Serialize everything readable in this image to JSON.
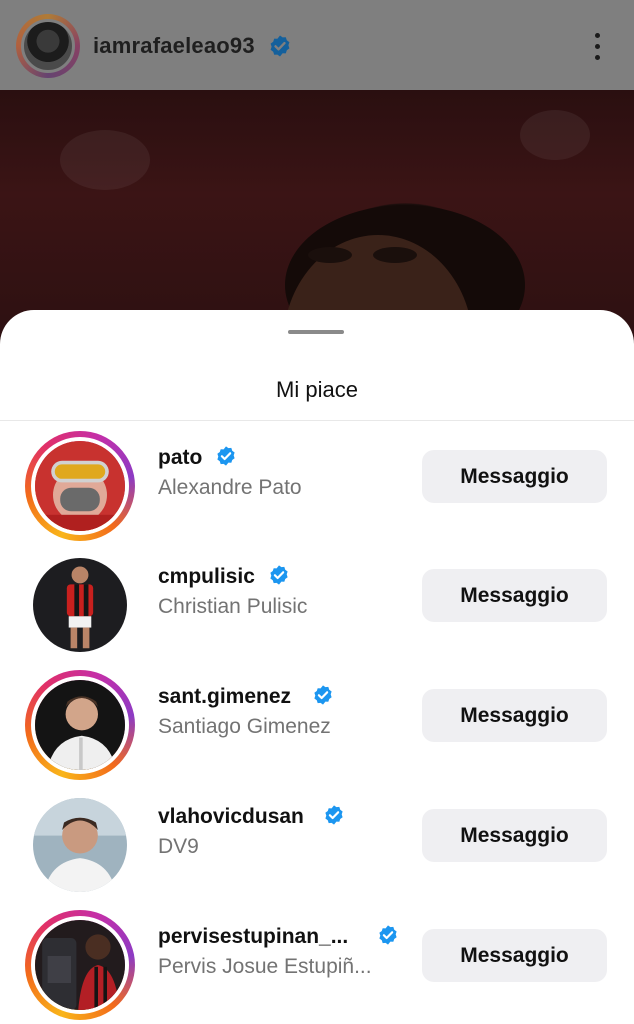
{
  "post": {
    "username": "iamrafaeleao93",
    "verified_icon": "verified-badge-icon",
    "more_icon": "more-vertical-icon"
  },
  "sheet": {
    "title": "Mi piace"
  },
  "likes": [
    {
      "username": "pato",
      "full_name": "Alexandre Pato",
      "story_ring": true,
      "button": "Messaggio"
    },
    {
      "username": "cmpulisic",
      "full_name": "Christian Pulisic",
      "story_ring": false,
      "button": "Messaggio"
    },
    {
      "username": "sant.gimenez",
      "full_name": "Santiago Gimenez",
      "story_ring": true,
      "button": "Messaggio"
    },
    {
      "username": "vlahovicdusan",
      "full_name": "DV9",
      "story_ring": false,
      "button": "Messaggio"
    },
    {
      "username": "pervisestupinan_...",
      "full_name": "Pervis Josue Estupiñ...",
      "story_ring": true,
      "button": "Messaggio"
    }
  ],
  "colors": {
    "verified_blue": "#1c96f0",
    "button_bg": "#efeff2",
    "secondary_text": "#737373"
  }
}
